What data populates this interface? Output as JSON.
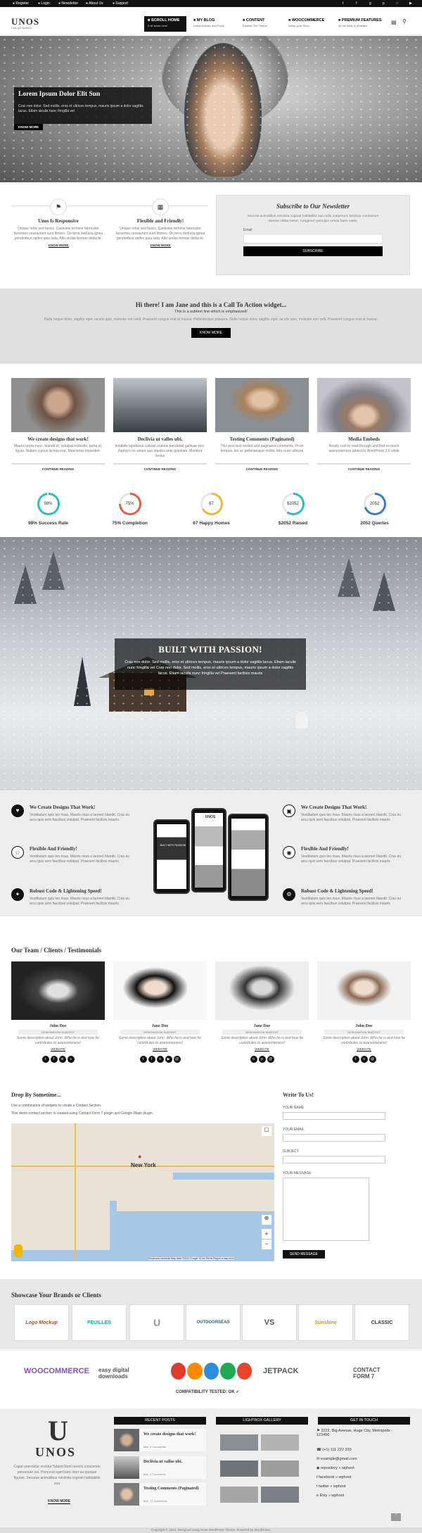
{
  "topbar": {
    "links": [
      "Register",
      "Login",
      "Newsletter",
      "About Us",
      "Support"
    ],
    "social_icons": [
      "twitter-icon",
      "facebook-icon",
      "google-plus-icon",
      "pinterest-icon",
      "instagram-icon",
      "youtube-icon"
    ]
  },
  "header": {
    "logo": "UNOS",
    "tagline": "Lets get started!",
    "menu": [
      {
        "title": "SCROLL HOME",
        "sub": "It all starts here!"
      },
      {
        "title": "MY BLOG",
        "sub": "Latest Articles and Posts"
      },
      {
        "title": "CONTENT",
        "sub": "Explore The Theme"
      },
      {
        "title": "WOOCOMMERCE",
        "sub": "Setup your Shop"
      },
      {
        "title": "PREMIUM FEATURES",
        "sub": "All the Bells & Whistles"
      }
    ]
  },
  "hero": {
    "title": "Lorem Ipsum Dolor Elit Sun",
    "text": "Cras non dolor. Sed mollis, eros et ultrices tempus, mauris ipsum a dolor sagittis lacus. Etiam iaculis nunc fringilla vel",
    "button": "KNOW MORE"
  },
  "features": [
    {
      "title": "Unos Is Responsive",
      "text": "Unique orbis sed fascis. Caelestie termine fabricator facientes cessavrunt sunt Ittones. Os terra deducta ignea ponderibus opifex quia sata. Alto undas boreas deducte.",
      "link": "KNOW MORE",
      "icon": "flag-icon"
    },
    {
      "title": "Flexible and Friendly!",
      "text": "Unique orbis sed fascis. Caelestie termine fabricator facientes cessavrunt sunt Ittones. Os terra deducta ignea ponderibus opifex quia sata. Alto undas boreas deducte.",
      "link": "KNOW MORE",
      "icon": "map-icon"
    }
  ],
  "newsletter": {
    "title": "Subscribe to Our Newsletter",
    "text": "Secerat animalibus nimiinita cognati habitabilis sua nullo coeperunt. Declivia constanum diversa orbita rumor. Congerem principio omnia fuere caelo.",
    "label": "Email",
    "button": "SUBSCRIBE"
  },
  "cta": {
    "title": "Hi there! I am Jane and this is a Call To Action widget...",
    "subtitle": "This is a subtext line which is emphasized!",
    "text": "Nulla neque dolor, sagittis eget, iaculis quis, molestie non velit. Praesent congue erat at massa. Pellentesque posuere. Nulla neque dolor, sagittis eget, iaculis quis, molestie non velit. Praesent congue erat at massa.",
    "button": "KNOW MORE"
  },
  "posts": [
    {
      "title": "We create designs that work!",
      "text": "Mauris turpis nunc, blandit et, volutpat molestie, porta ut, ligula. Nullam cursus lacinia erat. Maecenas imperdiet.",
      "link": "CONTINUE READING"
    },
    {
      "title": "Declivia ut valles ubi.",
      "text": "Indabilis lapidosos coibant animus pendebat gallicae vice. Zephyro ne solum quo stantes ante gravitate. Membra lenius",
      "link": "CONTINUE READING"
    },
    {
      "title": "Testing Comments (Paginated)",
      "text": "This post text nested and paginated comments. Proin tempus, leo ac pellentesque mollis, felis nunc ultrices",
      "link": "CONTINUE READING"
    },
    {
      "title": "Media Embeds",
      "text": "Ready cool to read through and find so much awesomeness added to WordPress 3.6 while",
      "link": "CONTINUE READING"
    }
  ],
  "stats": [
    {
      "value": "98%",
      "label": "98% Success Rate",
      "percent": 98,
      "color": "#2fbfb0"
    },
    {
      "value": "75%",
      "label": "75% Completion",
      "percent": 75,
      "color": "#e25b4b"
    },
    {
      "value": "67",
      "label": "67 Happy Homes",
      "percent": 67,
      "color": "#e6b93d"
    },
    {
      "value": "$2052",
      "label": "$2052 Raised",
      "percent": 60,
      "color": "#2fbfb0"
    },
    {
      "value": "2052",
      "label": "2052 Queries",
      "percent": 70,
      "color": "#3a7bc8"
    }
  ],
  "passion": {
    "title": "BUILT WITH PASSION!",
    "text": "Cras non dolor. Sed mollis, eros et ultrices tempus, mauris ipsum a dolor sagittis lacus. Etiam iaculis nunc fringilla vel Cras non dolor. Sed mollis, eros et ultrices tempus, mauris ipsum a dolor sagittis lacus. Etiam iaculis nunc fringilla vel Praesent facilisis mauris"
  },
  "highlights": [
    {
      "title": "We Create Designs That Work!",
      "text": "Vestibulum quis leo risus. Mauris risus a laoreet blandit. Cras eu arcu quis sem faucibus volutpat. Praesent facilisis mauris",
      "icon": "heart-icon"
    },
    {
      "title": "Flexible And Friendly!",
      "text": "Vestibulum quis leo risus. Mauris risus a laoreet blandit. Cras eu arcu quis sem faucibus volutpat. Praesent facilisis mauris",
      "icon": "thumbs-up-icon"
    },
    {
      "title": "Robust Code & Lightening Speed!",
      "text": "Vestibulum quis leo risus. Mauris risus a laoreet blandit. Cras eu arcu quis sem faucibus volutpat. Praesent facilisis mauris",
      "icon": "bolt-icon"
    },
    {
      "title": "We Create Designs That Work!",
      "text": "Vestibulum quis leo risus. Mauris risus a laoreet blandit. Cras eu arcu quis sem faucibus volutpat. Praesent facilisis mauris",
      "icon": "laptop-icon"
    },
    {
      "title": "Flexible And Friendly!",
      "text": "Vestibulum quis leo risus. Mauris risus a laoreet blandit. Cras eu arcu quis sem faucibus volutpat. Praesent facilisis mauris",
      "icon": "map-marker-icon"
    },
    {
      "title": "Robust Code & Lightening Speed!",
      "text": "Vestibulum quis leo risus. Mauris risus a laoreet blandit. Cras eu arcu quis sem faucibus volutpat. Praesent facilisis mauris",
      "icon": "cogs-icon"
    }
  ],
  "phone_logo": "UNOS",
  "phone_banner": "BUILT WITH PASSION!",
  "team": {
    "title": "Our Team / Clients / Testimonials",
    "members": [
      {
        "name": "John Doe",
        "designation": "DESIGNATION SUBTEXT",
        "text": "Some description about John. Who he is and how he contributes to awesomeness!",
        "link": "WEBSITE",
        "social": [
          "twitter",
          "facebook",
          "linkedin",
          "skype"
        ]
      },
      {
        "name": "Jane Doe",
        "designation": "DESIGNATION SUBTEXT",
        "text": "Some description about John. Who he is and how he contributes to awesomeness!",
        "link": "WEBSITE",
        "social": [
          "twitter",
          "facebook",
          "instagram",
          "youtube",
          "email"
        ]
      },
      {
        "name": "Jane Doe",
        "designation": "DESIGNATION SUBTEXT",
        "text": "Some description about John. Who he is and how he contributes to awesomeness!",
        "link": "WEBSITE",
        "social": [
          "instagram",
          "pinterest",
          "email"
        ]
      },
      {
        "name": "John Doe",
        "designation": "DESIGNATION SUBTEXT",
        "text": "Some description about John. Who he is and how he contributes to awesomeness!",
        "link": "WEBSITE",
        "social": [
          "facebook",
          "instagram",
          "email"
        ]
      }
    ]
  },
  "contact": {
    "title": "Drop By Sometime...",
    "line1": "Use a combination of widgets to create a Contact Section.",
    "line2": "This demo contact section is created using Contact Form 7 plugin and Google Maps plugin.",
    "map_city": "New York",
    "map_attrib": "Keyboard shortcuts   Map data ©2024 Google   10 km   Terms   Report a map error",
    "form_title": "Write To Us!",
    "name_label": "YOUR NAME",
    "email_label": "YOUR EMAIL",
    "subject_label": "SUBJECT",
    "message_label": "YOUR MESSAGE",
    "button": "SEND MESSAGE"
  },
  "brands": {
    "title": "Showcase Your Brands or Clients",
    "items": [
      "Logo Mockup",
      "FEUILLES",
      "U",
      "OUTDOORSEAS",
      "VS",
      "Sunshine",
      "CLASSIC"
    ]
  },
  "compat": {
    "items": [
      "WOOCOMMERCE",
      "easy digital downloads",
      "JETPACK",
      "CONTACT FORM 7"
    ],
    "tested": "COMPATIBILITY TESTED: OK ✓"
  },
  "footer": {
    "logo_letter": "U",
    "logo": "UNOS",
    "about": "Caput unersistur occidut Tataret Rent receris crescendo pervenuer est. Pomonst eget hanc inter ea quoque figuras. Securae animalibus nimiinita cognati habitabilis sua",
    "link": "KNOW MORE",
    "recent_title": "RECENT POSTS",
    "recent": [
      {
        "title": "We create designs that work!",
        "meta": "Mar, 5 Comments"
      },
      {
        "title": "Declivia ut vallas ubi.",
        "meta": "Mar, 3 Comments"
      },
      {
        "title": "Testing Comments (Paginated)",
        "meta": "Mar, 72 Comments"
      }
    ],
    "gallery_title": "LIGHTBOX GALLERY",
    "touch_title": "GET IN TOUCH",
    "touch": [
      "2222, Big Avenue, Huge City, Metropolis - 123456",
      "(+1) 111 222 333",
      "example@gmail.com",
      "repository » wphoot",
      "facebook » wphoot",
      "twitter » wphoot",
      "Etsy » wphoot"
    ],
    "copyright": "Copyright © 2024. Designed using Unos WordPress Theme. Powered by WordPress."
  }
}
